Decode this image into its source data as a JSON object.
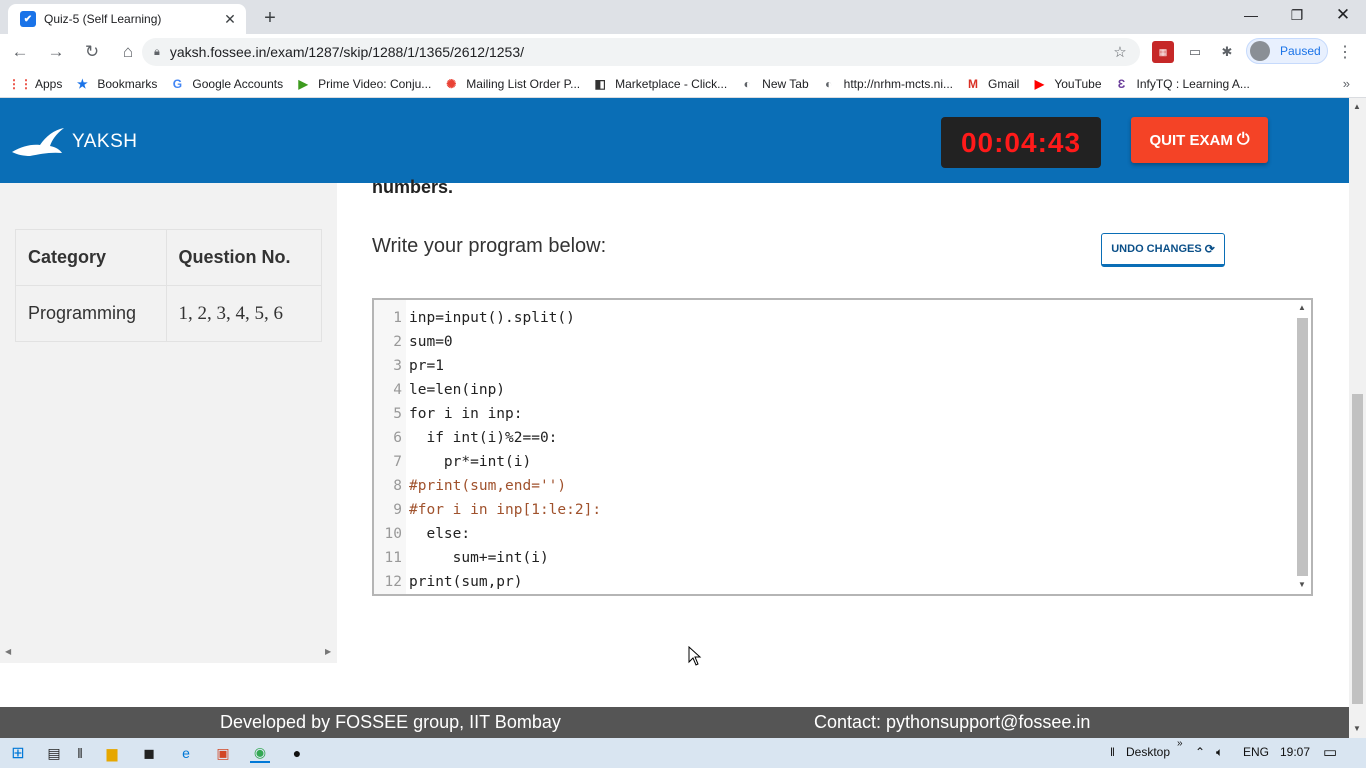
{
  "browser": {
    "tab_title": "Quiz-5 (Self Learning)",
    "url": "yaksh.fossee.in/exam/1287/skip/1288/1/1365/2612/1253/",
    "profile_label": "Paused",
    "bookmarks": [
      {
        "label": "Apps",
        "icon": "apps-grid-icon",
        "color": "#e94235"
      },
      {
        "label": "Bookmarks",
        "icon": "star-icon",
        "color": "#1a73e8"
      },
      {
        "label": "Google Accounts",
        "icon": "google-icon",
        "color": "#4285f4"
      },
      {
        "label": "Prime Video: Conju...",
        "icon": "prime-video-icon",
        "color": "#3d9b1f"
      },
      {
        "label": "Mailing List Order P...",
        "icon": "mailing-icon",
        "color": "#e94235"
      },
      {
        "label": "Marketplace - Click...",
        "icon": "marketplace-icon",
        "color": "#333333"
      },
      {
        "label": "New Tab",
        "icon": "globe-icon",
        "color": "#5f6368"
      },
      {
        "label": "http://nrhm-mcts.ni...",
        "icon": "globe-icon",
        "color": "#5f6368"
      },
      {
        "label": "Gmail",
        "icon": "gmail-icon",
        "color": "#d93025"
      },
      {
        "label": "YouTube",
        "icon": "youtube-icon",
        "color": "#ff0000"
      },
      {
        "label": "InfyTQ : Learning A...",
        "icon": "infytq-icon",
        "color": "#6a3d9a"
      }
    ]
  },
  "header": {
    "logo_text": "YAKSH",
    "timer": "00:04:43",
    "quit_label": "QUIT EXAM"
  },
  "sidebar": {
    "headers": [
      "Category",
      "Question No."
    ],
    "rows": [
      [
        "Programming",
        "1, 2, 3, 4, 5, 6"
      ]
    ]
  },
  "question": {
    "tail_text": "numbers.",
    "prompt": "Write your program below:",
    "undo_label": "UNDO CHANGES"
  },
  "editor": {
    "lines": [
      {
        "n": "1",
        "code": "inp=input().split()",
        "comment": false
      },
      {
        "n": "2",
        "code": "sum=0",
        "comment": false
      },
      {
        "n": "3",
        "code": "pr=1",
        "comment": false
      },
      {
        "n": "4",
        "code": "le=len(inp)",
        "comment": false
      },
      {
        "n": "5",
        "code": "for i in inp:",
        "comment": false
      },
      {
        "n": "6",
        "code": "  if int(i)%2==0:",
        "comment": false
      },
      {
        "n": "7",
        "code": "    pr*=int(i)",
        "comment": false
      },
      {
        "n": "8",
        "code": "#print(sum,end='')",
        "comment": true
      },
      {
        "n": "9",
        "code": "#for i in inp[1:le:2]:",
        "comment": true
      },
      {
        "n": "10",
        "code": "  else:",
        "comment": false
      },
      {
        "n": "11",
        "code": "     sum+=int(i)",
        "comment": false
      },
      {
        "n": "12",
        "code": "print(sum,pr)",
        "comment": false
      }
    ]
  },
  "footer": {
    "developed_by": "Developed by FOSSEE group, IIT Bombay",
    "contact": "Contact: pythonsupport@fossee.in"
  },
  "taskbar": {
    "desktop_label": "Desktop",
    "language": "ENG",
    "time": "19:07"
  },
  "colors": {
    "header_blue": "#0a6eb6",
    "timer_red": "#ff1a1a",
    "quit_red": "#f44326",
    "footer_gray": "#555555"
  }
}
